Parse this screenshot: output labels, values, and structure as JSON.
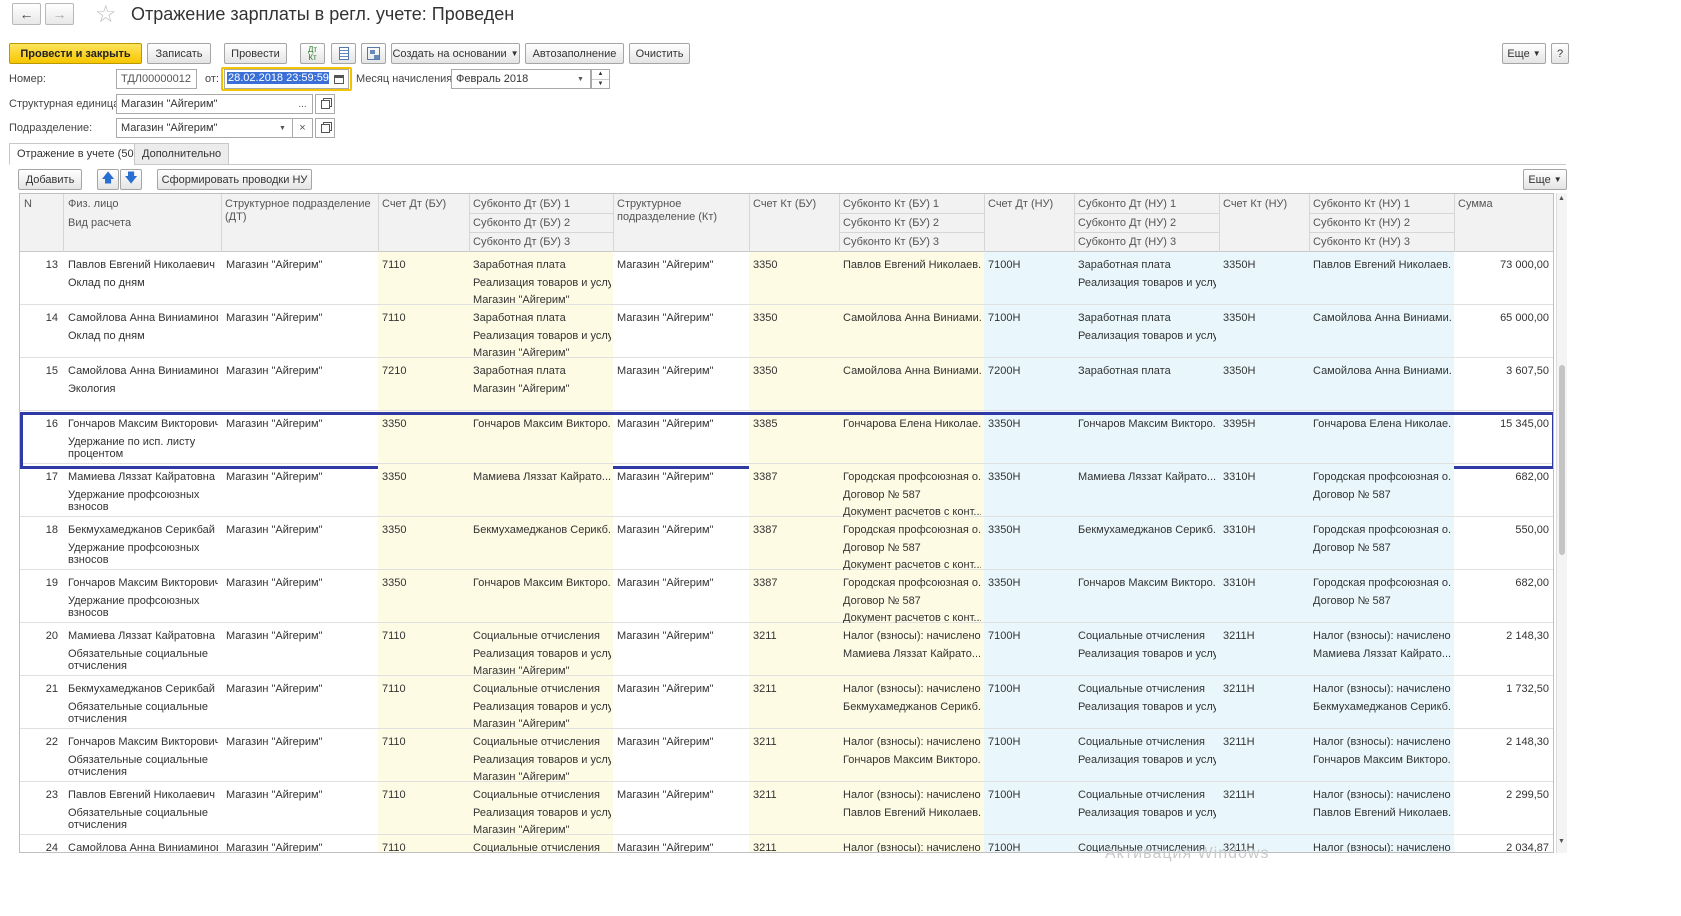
{
  "title": "Отражение зарплаты в регл. учете: Проведен",
  "toolbar": {
    "post_close": "Провести и закрыть",
    "save": "Записать",
    "post": "Провести",
    "dtkt_label": "Дт Кт",
    "create_based": "Создать на основании",
    "autofill": "Автозаполнение",
    "clear": "Очистить",
    "more": "Еще",
    "help": "?"
  },
  "form": {
    "number_label": "Номер:",
    "number_value": "ТДЛ00000012",
    "date_label": "от:",
    "date_value": "28.02.2018 23:59:59",
    "month_label": "Месяц начисления:",
    "month_value": "Февраль 2018",
    "struct_label": "Структурная единица:",
    "struct_value": "Магазин \"Айгерим\"",
    "dept_label": "Подразделение:",
    "dept_value": "Магазин \"Айгерим\""
  },
  "tabs": [
    "Отражение в учете (50)",
    "Дополнительно"
  ],
  "table_toolbar": {
    "add": "Добавить",
    "form_nu": "Сформировать проводки НУ",
    "more": "Еще"
  },
  "columns": {
    "n": "N",
    "person": "Физ. лицо",
    "calc_type": "Вид расчета",
    "dept_dt": [
      "Структурное подразделение",
      "(ДТ)"
    ],
    "acc_dt_bu": "Счет Дт (БУ)",
    "sub_dt_bu": [
      "Субконто Дт (БУ) 1",
      "Субконто Дт (БУ) 2",
      "Субконто Дт (БУ) 3"
    ],
    "dept_kt": [
      "Структурное",
      "подразделение (Кт)"
    ],
    "acc_kt_bu": "Счет Кт (БУ)",
    "sub_kt_bu": [
      "Субконто Кт (БУ) 1",
      "Субконто Кт (БУ) 2",
      "Субконто Кт (БУ) 3"
    ],
    "acc_dt_nu": "Счет Дт (НУ)",
    "sub_dt_nu": [
      "Субконто Дт (НУ) 1",
      "Субконто Дт (НУ) 2",
      "Субконто Дт (НУ) 3"
    ],
    "acc_kt_nu": "Счет Кт (НУ)",
    "sub_kt_nu": [
      "Субконто Кт (НУ) 1",
      "Субконто Кт (НУ) 2",
      "Субконто Кт (НУ) 3"
    ],
    "sum": "Сумма"
  },
  "rows": [
    {
      "n": "13",
      "person": "Павлов Евгений Николаевич",
      "calc": [
        "Оклад по дням"
      ],
      "dept_dt": "Магазин \"Айгерим\"",
      "acc_dt_bu": "7110",
      "sub_dt_bu": [
        "Заработная плата",
        "Реализация товаров и услуг",
        "Магазин \"Айгерим\""
      ],
      "dept_kt": "Магазин \"Айгерим\"",
      "acc_kt_bu": "3350",
      "sub_kt_bu": [
        "Павлов Евгений Николаев..."
      ],
      "acc_dt_nu": "7100Н",
      "sub_dt_nu": [
        "Заработная плата",
        "Реализация товаров и услуг"
      ],
      "acc_kt_nu": "3350Н",
      "sub_kt_nu": [
        "Павлов Евгений Николаев..."
      ],
      "sum": "73 000,00"
    },
    {
      "n": "14",
      "person": "Самойлова Анна Виниаминов...",
      "calc": [
        "Оклад по дням"
      ],
      "dept_dt": "Магазин \"Айгерим\"",
      "acc_dt_bu": "7110",
      "sub_dt_bu": [
        "Заработная плата",
        "Реализация товаров и услуг",
        "Магазин \"Айгерим\""
      ],
      "dept_kt": "Магазин \"Айгерим\"",
      "acc_kt_bu": "3350",
      "sub_kt_bu": [
        "Самойлова Анна Виниами..."
      ],
      "acc_dt_nu": "7100Н",
      "sub_dt_nu": [
        "Заработная плата",
        "Реализация товаров и услуг"
      ],
      "acc_kt_nu": "3350Н",
      "sub_kt_nu": [
        "Самойлова Анна Виниами..."
      ],
      "sum": "65 000,00"
    },
    {
      "n": "15",
      "person": "Самойлова Анна Виниаминов...",
      "calc": [
        "Экология"
      ],
      "dept_dt": "Магазин \"Айгерим\"",
      "acc_dt_bu": "7210",
      "sub_dt_bu": [
        "Заработная плата",
        "Магазин \"Айгерим\""
      ],
      "dept_kt": "Магазин \"Айгерим\"",
      "acc_kt_bu": "3350",
      "sub_kt_bu": [
        "Самойлова Анна Виниами..."
      ],
      "acc_dt_nu": "7200Н",
      "sub_dt_nu": [
        "Заработная плата"
      ],
      "acc_kt_nu": "3350Н",
      "sub_kt_nu": [
        "Самойлова Анна Виниами..."
      ],
      "sum": "3 607,50"
    },
    {
      "n": "16",
      "person": "Гончаров Максим Викторович",
      "calc": [
        "Удержание по исп. листу",
        "процентом"
      ],
      "dept_dt": "Магазин \"Айгерим\"",
      "acc_dt_bu": "3350",
      "sub_dt_bu": [
        "Гончаров Максим Викторо..."
      ],
      "dept_kt": "Магазин \"Айгерим\"",
      "acc_kt_bu": "3385",
      "sub_kt_bu": [
        "Гончарова Елена Николае..."
      ],
      "acc_dt_nu": "3350Н",
      "sub_dt_nu": [
        "Гончаров Максим Викторо..."
      ],
      "acc_kt_nu": "3395Н",
      "sub_kt_nu": [
        "Гончарова Елена Николае..."
      ],
      "sum": "15 345,00"
    },
    {
      "n": "17",
      "person": "Мамиева Ляззат Кайратовна",
      "calc": [
        "Удержание профсоюзных",
        "взносов"
      ],
      "dept_dt": "Магазин \"Айгерим\"",
      "acc_dt_bu": "3350",
      "sub_dt_bu": [
        "Мамиева Ляззат Кайрато..."
      ],
      "dept_kt": "Магазин \"Айгерим\"",
      "acc_kt_bu": "3387",
      "sub_kt_bu": [
        "Городская профсоюзная о...",
        "Договор № 587",
        "Документ расчетов с конт..."
      ],
      "acc_dt_nu": "3350Н",
      "sub_dt_nu": [
        "Мамиева Ляззат Кайрато..."
      ],
      "acc_kt_nu": "3310Н",
      "sub_kt_nu": [
        "Городская профсоюзная о...",
        "Договор № 587"
      ],
      "sum": "682,00"
    },
    {
      "n": "18",
      "person": "Бекмухамеджанов Серикбай ...",
      "calc": [
        "Удержание профсоюзных",
        "взносов"
      ],
      "dept_dt": "Магазин \"Айгерим\"",
      "acc_dt_bu": "3350",
      "sub_dt_bu": [
        "Бекмухамеджанов Серикб..."
      ],
      "dept_kt": "Магазин \"Айгерим\"",
      "acc_kt_bu": "3387",
      "sub_kt_bu": [
        "Городская профсоюзная о...",
        "Договор № 587",
        "Документ расчетов с конт..."
      ],
      "acc_dt_nu": "3350Н",
      "sub_dt_nu": [
        "Бекмухамеджанов Серикб..."
      ],
      "acc_kt_nu": "3310Н",
      "sub_kt_nu": [
        "Городская профсоюзная о...",
        "Договор № 587"
      ],
      "sum": "550,00"
    },
    {
      "n": "19",
      "person": "Гончаров Максим Викторович",
      "calc": [
        "Удержание профсоюзных",
        "взносов"
      ],
      "dept_dt": "Магазин \"Айгерим\"",
      "acc_dt_bu": "3350",
      "sub_dt_bu": [
        "Гончаров Максим Викторо..."
      ],
      "dept_kt": "Магазин \"Айгерим\"",
      "acc_kt_bu": "3387",
      "sub_kt_bu": [
        "Городская профсоюзная о...",
        "Договор № 587",
        "Документ расчетов с конт..."
      ],
      "acc_dt_nu": "3350Н",
      "sub_dt_nu": [
        "Гончаров Максим Викторо..."
      ],
      "acc_kt_nu": "3310Н",
      "sub_kt_nu": [
        "Городская профсоюзная о...",
        "Договор № 587"
      ],
      "sum": "682,00"
    },
    {
      "n": "20",
      "person": "Мамиева Ляззат Кайратовна",
      "calc": [
        "Обязательные социальные",
        "отчисления"
      ],
      "dept_dt": "Магазин \"Айгерим\"",
      "acc_dt_bu": "7110",
      "sub_dt_bu": [
        "Социальные отчисления",
        "Реализация товаров и услуг",
        "Магазин \"Айгерим\""
      ],
      "dept_kt": "Магазин \"Айгерим\"",
      "acc_kt_bu": "3211",
      "sub_kt_bu": [
        "Налог (взносы): начислено...",
        "Мамиева Ляззат Кайрато..."
      ],
      "acc_dt_nu": "7100Н",
      "sub_dt_nu": [
        "Социальные отчисления",
        "Реализация товаров и услуг"
      ],
      "acc_kt_nu": "3211Н",
      "sub_kt_nu": [
        "Налог (взносы): начислено...",
        "Мамиева Ляззат Кайрато..."
      ],
      "sum": "2 148,30"
    },
    {
      "n": "21",
      "person": "Бекмухамеджанов Серикбай ...",
      "calc": [
        "Обязательные социальные",
        "отчисления"
      ],
      "dept_dt": "Магазин \"Айгерим\"",
      "acc_dt_bu": "7110",
      "sub_dt_bu": [
        "Социальные отчисления",
        "Реализация товаров и услуг",
        "Магазин \"Айгерим\""
      ],
      "dept_kt": "Магазин \"Айгерим\"",
      "acc_kt_bu": "3211",
      "sub_kt_bu": [
        "Налог (взносы): начислено...",
        "Бекмухамеджанов Серикб..."
      ],
      "acc_dt_nu": "7100Н",
      "sub_dt_nu": [
        "Социальные отчисления",
        "Реализация товаров и услуг"
      ],
      "acc_kt_nu": "3211Н",
      "sub_kt_nu": [
        "Налог (взносы): начислено...",
        "Бекмухамеджанов Серикб..."
      ],
      "sum": "1 732,50"
    },
    {
      "n": "22",
      "person": "Гончаров Максим Викторович",
      "calc": [
        "Обязательные социальные",
        "отчисления"
      ],
      "dept_dt": "Магазин \"Айгерим\"",
      "acc_dt_bu": "7110",
      "sub_dt_bu": [
        "Социальные отчисления",
        "Реализация товаров и услуг",
        "Магазин \"Айгерим\""
      ],
      "dept_kt": "Магазин \"Айгерим\"",
      "acc_kt_bu": "3211",
      "sub_kt_bu": [
        "Налог (взносы): начислено...",
        "Гончаров Максим Викторо..."
      ],
      "acc_dt_nu": "7100Н",
      "sub_dt_nu": [
        "Социальные отчисления",
        "Реализация товаров и услуг"
      ],
      "acc_kt_nu": "3211Н",
      "sub_kt_nu": [
        "Налог (взносы): начислено...",
        "Гончаров Максим Викторо..."
      ],
      "sum": "2 148,30"
    },
    {
      "n": "23",
      "person": "Павлов Евгений Николаевич",
      "calc": [
        "Обязательные социальные",
        "отчисления"
      ],
      "dept_dt": "Магазин \"Айгерим\"",
      "acc_dt_bu": "7110",
      "sub_dt_bu": [
        "Социальные отчисления",
        "Реализация товаров и услуг",
        "Магазин \"Айгерим\""
      ],
      "dept_kt": "Магазин \"Айгерим\"",
      "acc_kt_bu": "3211",
      "sub_kt_bu": [
        "Налог (взносы): начислено...",
        "Павлов Евгений Николаев..."
      ],
      "acc_dt_nu": "7100Н",
      "sub_dt_nu": [
        "Социальные отчисления",
        "Реализация товаров и услуг"
      ],
      "acc_kt_nu": "3211Н",
      "sub_kt_nu": [
        "Налог (взносы): начислено...",
        "Павлов Евгений Николаев..."
      ],
      "sum": "2 299,50"
    },
    {
      "n": "24",
      "person": "Самойлова Анна Виниаминов...",
      "calc": [],
      "dept_dt": "Магазин \"Айгерим\"",
      "acc_dt_bu": "7110",
      "sub_dt_bu": [
        "Социальные отчисления"
      ],
      "dept_kt": "Магазин \"Айгерим\"",
      "acc_kt_bu": "3211",
      "sub_kt_bu": [
        "Налог (взносы): начислено..."
      ],
      "acc_dt_nu": "7100Н",
      "sub_dt_nu": [
        "Социальные отчисления"
      ],
      "acc_kt_nu": "3211Н",
      "sub_kt_nu": [
        "Налог (взносы): начислено..."
      ],
      "sum": "2 034,87"
    }
  ],
  "selected_row": "16",
  "watermark": "Активация Windows",
  "colors": {
    "bu_band": "#fdfbe4",
    "nu_band": "#e9f7fc",
    "selection": "#2f3aa6",
    "primary_button": "#f7c600"
  }
}
